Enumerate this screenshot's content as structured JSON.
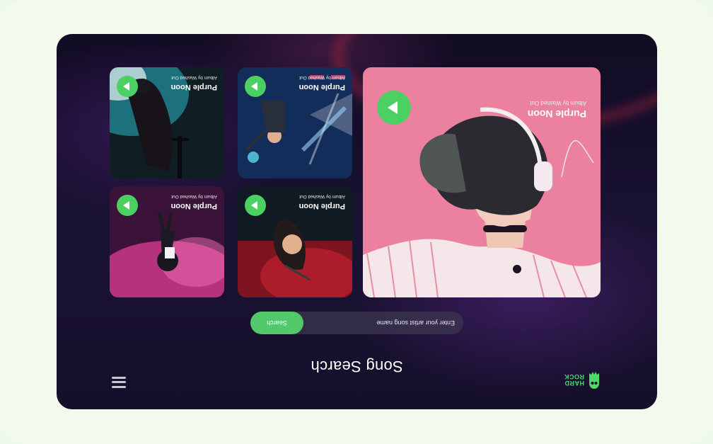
{
  "app": {
    "logo_text": "HARD\nROCK",
    "logo_line1": "HARD",
    "logo_line2": "ROCK",
    "title": "Song Search"
  },
  "search": {
    "placeholder": "Enter your artist song name",
    "button_label": "Search"
  },
  "featured": {
    "title": "Purple Noon",
    "subtitle": "Album by Washed Out"
  },
  "cards": [
    {
      "title": "Purple Noon",
      "subtitle": "Album by Washed Out"
    },
    {
      "title": "Purple Noon",
      "subtitle": "Album by Washed Out"
    },
    {
      "title": "Purple Noon",
      "subtitle": "Album by Washed Out"
    },
    {
      "title": "Purple Noon",
      "subtitle": "Album by Washed Out"
    }
  ],
  "colors": {
    "accent": "#4ccf63",
    "background": "#150f2a",
    "page": "#f1faec"
  },
  "icons": {
    "menu": "hamburger-menu-icon",
    "play": "play-icon",
    "logo": "hard-rock-logo"
  }
}
